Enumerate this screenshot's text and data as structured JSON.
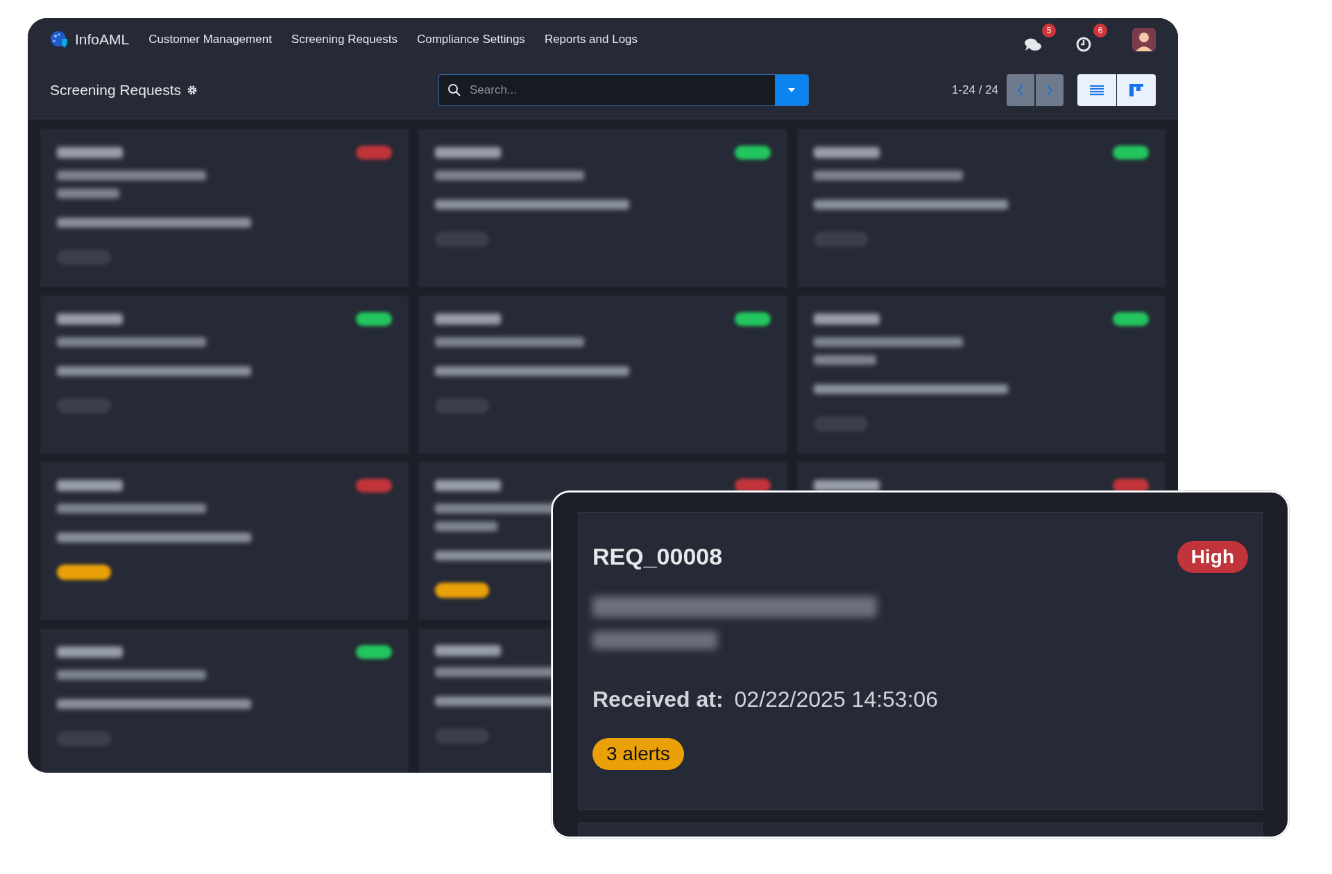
{
  "navbar": {
    "brand": "InfoAML",
    "menu": [
      "Customer Management",
      "Screening Requests",
      "Compliance Settings",
      "Reports and Logs"
    ],
    "notifications": [
      {
        "kind": "chat",
        "count": "5"
      },
      {
        "kind": "clock",
        "count": "6"
      }
    ]
  },
  "toolbar": {
    "title": "Screening Requests",
    "search": {
      "placeholder": "Search..."
    },
    "pager": "1-24 / 24"
  },
  "cards": [
    {
      "high_risk": true,
      "has_alerts": false,
      "wrap": true
    },
    {
      "high_risk": false,
      "has_alerts": false,
      "wrap": false
    },
    {
      "high_risk": false,
      "has_alerts": false,
      "wrap": false
    },
    {
      "high_risk": false,
      "has_alerts": false,
      "wrap": false
    },
    {
      "high_risk": false,
      "has_alerts": false,
      "wrap": false
    },
    {
      "high_risk": false,
      "has_alerts": false,
      "wrap": true
    },
    {
      "high_risk": true,
      "has_alerts": true,
      "wrap": false
    },
    {
      "high_risk": true,
      "has_alerts": true,
      "wrap": true
    },
    {
      "high_risk": true
    },
    {
      "high_risk": false,
      "has_alerts": false,
      "wrap": false
    },
    {
      "has_alerts": false,
      "wrap": false
    }
  ],
  "detail": {
    "id": "REQ_00008",
    "risk": "High",
    "received_label": "Received at:",
    "received_value": "02/22/2025 14:53:06",
    "alerts": "3 alerts"
  }
}
